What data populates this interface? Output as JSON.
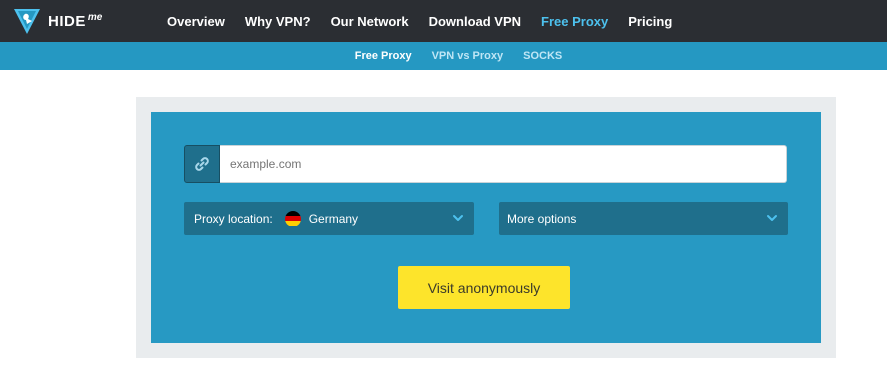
{
  "brand": {
    "name": "HIDE",
    "suffix": "me"
  },
  "nav": {
    "items": [
      {
        "label": "Overview",
        "active": false
      },
      {
        "label": "Why VPN?",
        "active": false
      },
      {
        "label": "Our Network",
        "active": false
      },
      {
        "label": "Download VPN",
        "active": false
      },
      {
        "label": "Free Proxy",
        "active": true
      },
      {
        "label": "Pricing",
        "active": false
      }
    ]
  },
  "subnav": {
    "items": [
      {
        "label": "Free Proxy",
        "active": true
      },
      {
        "label": "VPN vs Proxy",
        "active": false
      },
      {
        "label": "SOCKS",
        "active": false
      }
    ]
  },
  "proxy": {
    "url_placeholder": "example.com",
    "location_label": "Proxy location:",
    "location_value": "Germany",
    "location_icon": "germany-flag-icon",
    "more_options_label": "More options",
    "submit_label": "Visit anonymously"
  },
  "colors": {
    "topbar": "#2b2e33",
    "subbar": "#2598c2",
    "panel": "#2799c3",
    "select_bg": "#1f6f8c",
    "active_link": "#4dc1ee",
    "button": "#fde42b"
  }
}
